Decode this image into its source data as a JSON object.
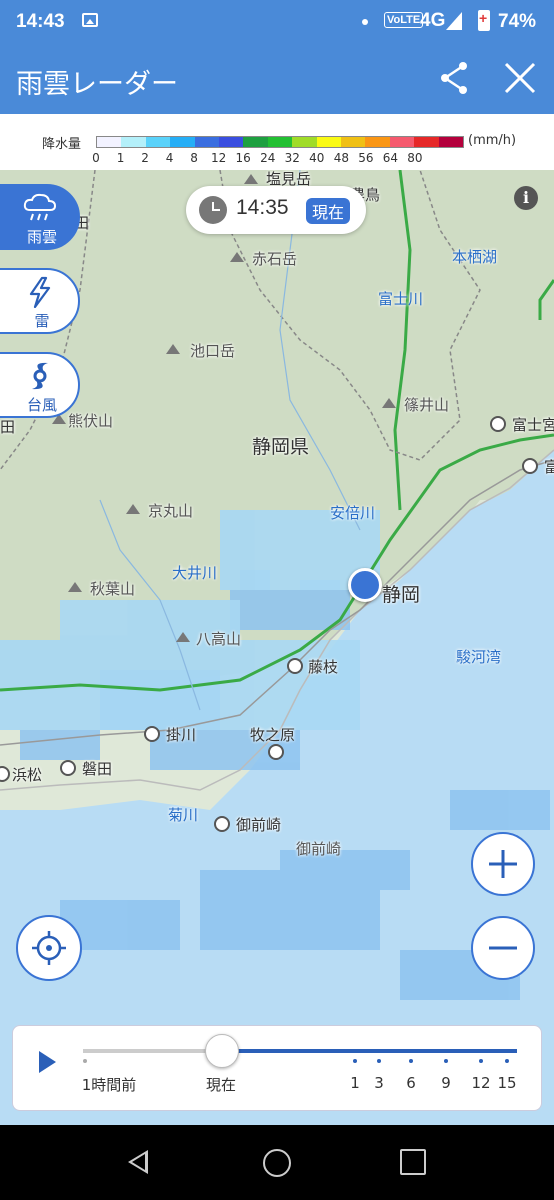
{
  "status_bar": {
    "time": "14:43",
    "volte": "VoLTE",
    "network": "4G",
    "battery_pct": "74%"
  },
  "app_bar": {
    "title": "雨雲レーダー",
    "share_icon": "share-icon",
    "close_icon": "close-icon"
  },
  "legend": {
    "label": "降水量",
    "unit": "(mm/h)",
    "ticks": [
      "0",
      "1",
      "2",
      "4",
      "8",
      "12",
      "16",
      "24",
      "32",
      "40",
      "48",
      "56",
      "64",
      "80"
    ],
    "colors": [
      "#f2f2ff",
      "#b4f0fa",
      "#5ad2fa",
      "#25aef6",
      "#3a6ee0",
      "#3a4ee0",
      "#1ea040",
      "#23c032",
      "#a0dc28",
      "#fafa14",
      "#f0c014",
      "#fa9614",
      "#f55a6e",
      "#e62828",
      "#b4003c"
    ]
  },
  "time_pill": {
    "time": "14:35",
    "now_label": "現在"
  },
  "layers": [
    {
      "label": "雨雲",
      "icon": "rain-cloud-icon",
      "active": true
    },
    {
      "label": "雷",
      "icon": "lightning-icon",
      "active": false
    },
    {
      "label": "台風",
      "icon": "typhoon-icon",
      "active": false
    }
  ],
  "map": {
    "places": {
      "shiojiri": "塩見岳",
      "notori": "農鳥",
      "akaishi": "赤石岳",
      "motosu": "本栖湖",
      "fujikawa": "富士川",
      "ikeguchi": "池口岳",
      "kumabushi": "熊伏山",
      "shinoi": "篠井山",
      "fujinomiya": "富士宮",
      "fuji": "富士",
      "shizuoka_pref": "静岡県",
      "kyomaru": "京丸山",
      "abekawa": "安倍川",
      "oigawa": "大井川",
      "akiha": "秋葉山",
      "shizuoka": "静岡",
      "hachiko": "八高山",
      "suruga": "駿河湾",
      "fujieda": "藤枝",
      "kakegawa": "掛川",
      "makinohara": "牧之原",
      "hamamatsu": "浜松",
      "iwata": "磐田",
      "kikugawa": "菊川",
      "omaezaki": "御前崎",
      "omaezaki_cape": "御前崎",
      "ida": "田",
      "iida": "田"
    }
  },
  "timeline": {
    "labels": {
      "past": "1時間前",
      "now": "現在",
      "h1": "1",
      "h3": "3",
      "h6": "6",
      "h9": "9",
      "h12": "12",
      "h15": "15"
    },
    "current_position": 0.32
  }
}
